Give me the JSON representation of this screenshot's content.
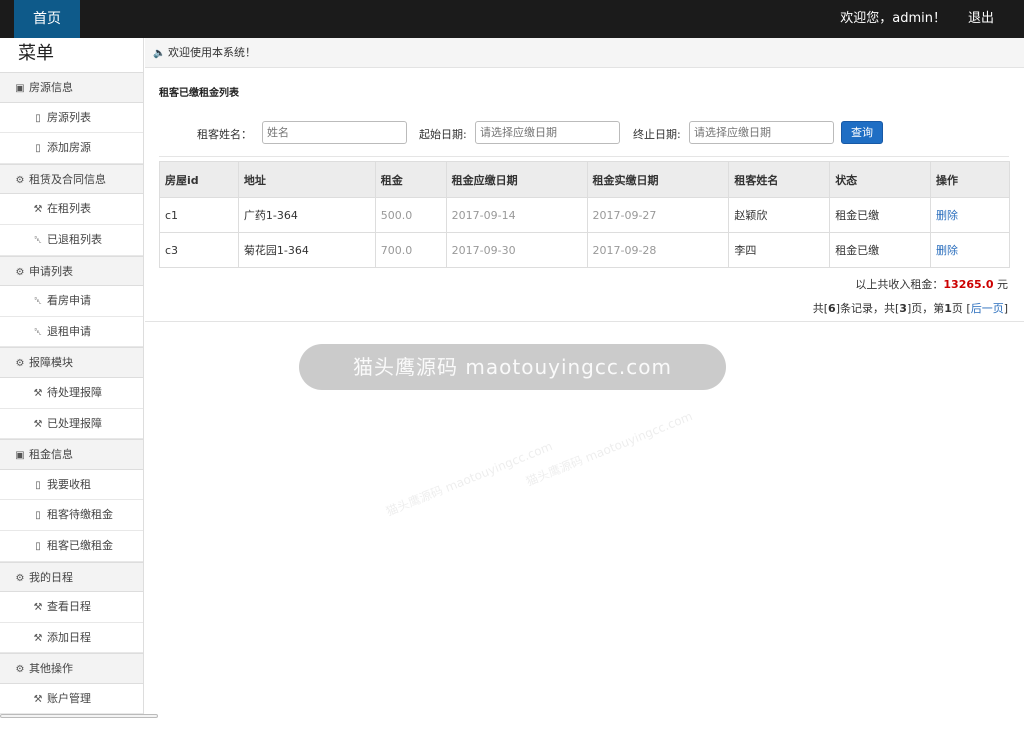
{
  "topbar": {
    "home_label": "首页",
    "welcome": "欢迎您，admin！",
    "logout": "退出"
  },
  "sidebar": {
    "title": "菜单",
    "groups": [
      {
        "label": "房源信息",
        "icon": "card-icon",
        "items": [
          {
            "label": "房源列表",
            "icon": "document-icon"
          },
          {
            "label": "添加房源",
            "icon": "document-icon"
          }
        ]
      },
      {
        "label": "租赁及合同信息",
        "icon": "gear-icon",
        "items": [
          {
            "label": "在租列表",
            "icon": "wrench-icon"
          },
          {
            "label": "已退租列表",
            "icon": "trash-icon"
          }
        ]
      },
      {
        "label": "申请列表",
        "icon": "gear-icon",
        "items": [
          {
            "label": "看房申请",
            "icon": "trash-icon"
          },
          {
            "label": "退租申请",
            "icon": "trash-icon"
          }
        ]
      },
      {
        "label": "报障模块",
        "icon": "gear-icon",
        "items": [
          {
            "label": "待处理报障",
            "icon": "wrench-icon"
          },
          {
            "label": "已处理报障",
            "icon": "wrench-icon"
          }
        ]
      },
      {
        "label": "租金信息",
        "icon": "card-icon",
        "items": [
          {
            "label": "我要收租",
            "icon": "document-icon"
          },
          {
            "label": "租客待缴租金",
            "icon": "document-icon"
          },
          {
            "label": "租客已缴租金",
            "icon": "document-icon"
          }
        ]
      },
      {
        "label": "我的日程",
        "icon": "gear-icon",
        "items": [
          {
            "label": "查看日程",
            "icon": "wrench-icon"
          },
          {
            "label": "添加日程",
            "icon": "wrench-icon"
          }
        ]
      },
      {
        "label": "其他操作",
        "icon": "gear-icon",
        "items": [
          {
            "label": "账户管理",
            "icon": "wrench-icon"
          }
        ]
      }
    ]
  },
  "crumb": "欢迎使用本系统！",
  "panel": {
    "title": "租客已缴租金列表",
    "search": {
      "name_label": "租客姓名：",
      "name_placeholder": "姓名",
      "start_label": "起始日期:",
      "start_placeholder": "请选择应缴日期",
      "end_label": "终止日期:",
      "end_placeholder": "请选择应缴日期",
      "button": "查询"
    },
    "table": {
      "headers": [
        "房屋id",
        "地址",
        "租金",
        "租金应缴日期",
        "租金实缴日期",
        "租客姓名",
        "状态",
        "操作"
      ],
      "rows": [
        [
          "c1",
          "广药1-364",
          "500.0",
          "2017-09-14",
          "2017-09-27",
          "赵颖欣",
          "租金已缴",
          "删除"
        ],
        [
          "c3",
          "菊花园1-364",
          "700.0",
          "2017-09-30",
          "2017-09-28",
          "李四",
          "租金已缴",
          "删除"
        ]
      ]
    },
    "summary_prefix": "以上共收入租金：",
    "summary_amount": "13265.0",
    "summary_unit": " 元",
    "pager": {
      "p1": "共[",
      "total": "6",
      "p2": "]条记录，共[",
      "pages": "3",
      "p3": "]页，第",
      "current": "1",
      "p4": "页 [",
      "next": "后一页",
      "p5": "]"
    }
  },
  "watermark": {
    "main": "猫头鹰源码 maotouyingcc.com",
    "small": "猫头鹰源码 maotouyingcc.com"
  },
  "colors": {
    "accent": "#0e5a8a",
    "button": "#1f6ec4",
    "amount": "#cc0000",
    "link": "#2a6ebd"
  }
}
